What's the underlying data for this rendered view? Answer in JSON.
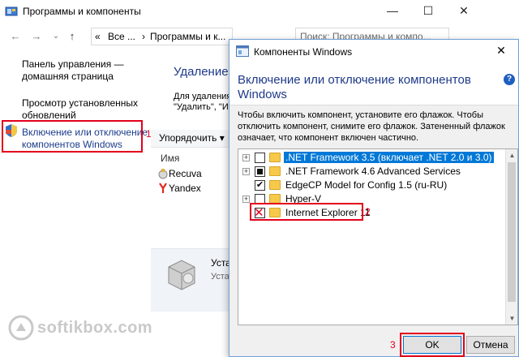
{
  "back_window": {
    "title": "Программы и компоненты",
    "controls": {
      "minimize": "—",
      "maximize": "☐",
      "close": "✕"
    },
    "nav": {
      "back": "←",
      "forward": "→",
      "dropdown": "⌄",
      "up": "↑"
    },
    "address": {
      "chevrons": "«",
      "part1": "Все ...",
      "sep": "›",
      "part2": "Программы и к..."
    },
    "search_placeholder": "Поиск: Программы и компо...",
    "left_pane": {
      "home_link": [
        "Панель управления —",
        "домашняя страница"
      ],
      "updates_link": [
        "Просмотр установленных",
        "обновлений"
      ],
      "features_link": [
        "Включение или отключение",
        "компонентов Windows"
      ],
      "features_marker": "1"
    },
    "main": {
      "heading": "Удаление",
      "sub_line1": "Для удаления",
      "sub_line2": "\"Удалить\", \"И",
      "organize": "Упорядочить ▾",
      "column_name": "Имя",
      "programs": [
        {
          "name": "Recuva",
          "icon": "recuva-icon"
        },
        {
          "name": "Yandex",
          "icon": "yandex-icon"
        }
      ],
      "detail_text1": "Уста",
      "detail_text2": "Уста"
    },
    "watermark": "softikbox.com"
  },
  "dialog": {
    "title": "Компоненты Windows",
    "close": "✕",
    "heading_line1": "Включение или отключение компонентов",
    "heading_line2": "Windows",
    "help": "?",
    "description": "Чтобы включить компонент, установите его флажок. Чтобы отключить компонент, снимите его флажок. Затененный флажок означает, что компонент включен частично.",
    "features": [
      {
        "label": ".NET Framework 3.5 (включает .NET 2.0 и 3.0)",
        "expand": "+",
        "state": "unchecked",
        "selected": true
      },
      {
        "label": ".NET Framework 4.6 Advanced Services",
        "expand": "+",
        "state": "partial",
        "selected": false
      },
      {
        "label": "EdgeCP Model for Config 1.5 (ru-RU)",
        "expand": "",
        "state": "checked",
        "selected": false
      },
      {
        "label": "Hyper-V",
        "expand": "+",
        "state": "unchecked",
        "selected": false
      },
      {
        "label": "Internet Explorer 11",
        "expand": "",
        "state": "unchecked-marked",
        "selected": false
      }
    ],
    "check_glyph": "✔",
    "red_x": "✕",
    "ie_marker": "2",
    "ok_marker": "3",
    "ok_label": "OK",
    "cancel_label": "Отмена",
    "scroll_up": "▲",
    "scroll_down": "▼"
  },
  "colors": {
    "highlight": "#e3001b",
    "heading_blue": "#1e3a8a",
    "selection": "#0078d7"
  }
}
